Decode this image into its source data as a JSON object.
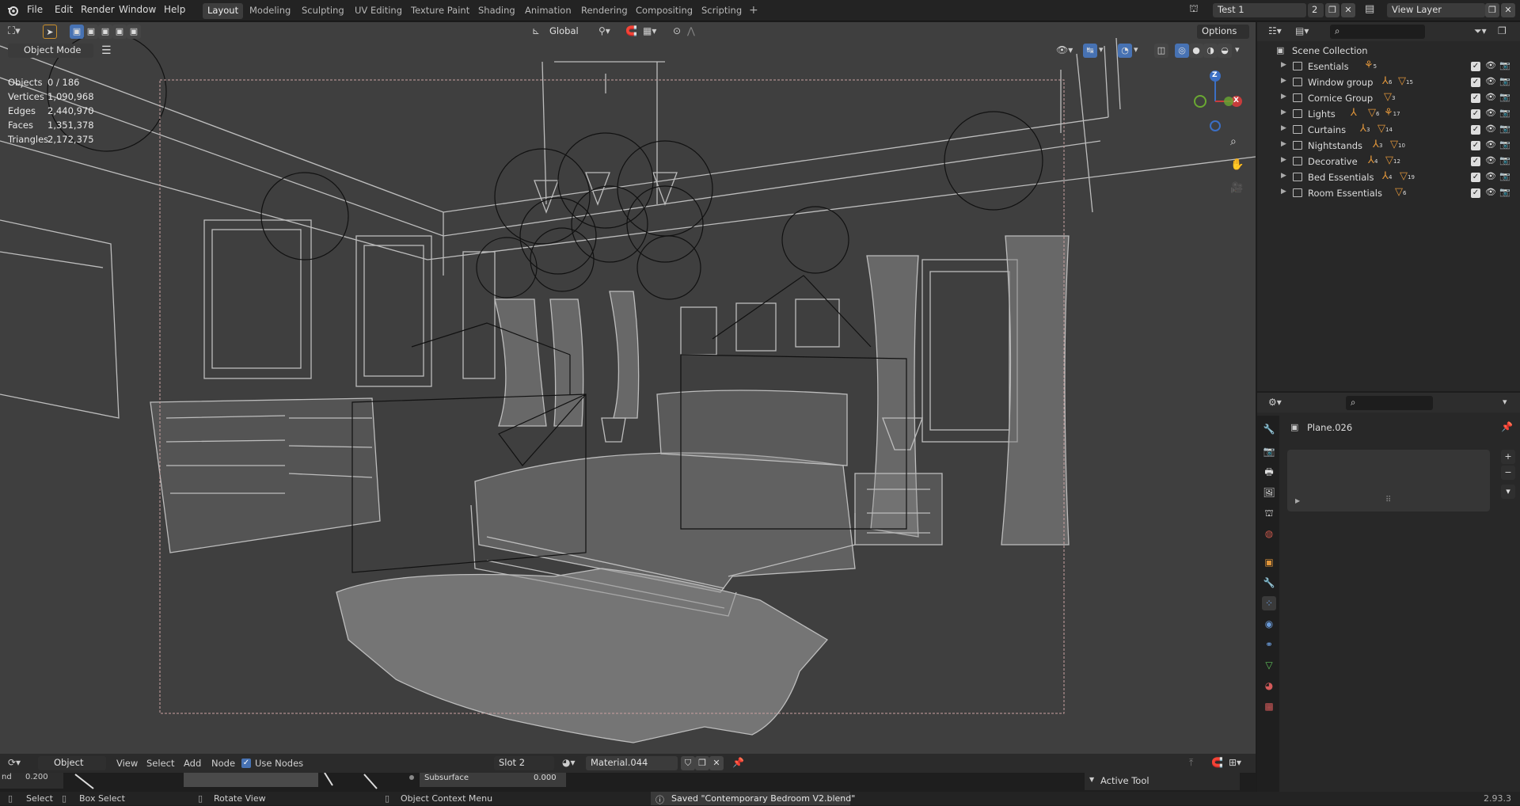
{
  "menus": {
    "file": "File",
    "edit": "Edit",
    "render": "Render",
    "window": "Window",
    "help": "Help"
  },
  "workspaces": [
    "Layout",
    "Modeling",
    "Sculpting",
    "UV Editing",
    "Texture Paint",
    "Shading",
    "Animation",
    "Rendering",
    "Compositing",
    "Scripting"
  ],
  "scene": {
    "name": "Test 1",
    "users": "2",
    "view_layer": "View Layer"
  },
  "viewport": {
    "mode": "Object Mode",
    "orientation": "Global",
    "options": "Options",
    "stats": [
      {
        "label": "Objects",
        "value": "0 / 186"
      },
      {
        "label": "Vertices",
        "value": "1,090,968"
      },
      {
        "label": "Edges",
        "value": "2,440,970"
      },
      {
        "label": "Faces",
        "value": "1,351,378"
      },
      {
        "label": "Triangles",
        "value": "2,172,375"
      }
    ],
    "gizmo": {
      "z": "Z",
      "x": "X"
    }
  },
  "outliner": {
    "root": "Scene Collection",
    "items": [
      {
        "name": "Esentials",
        "badges": [
          "5"
        ]
      },
      {
        "name": "Window group",
        "badges": [
          "6",
          "15"
        ]
      },
      {
        "name": "Cornice Group",
        "badges": [
          "3"
        ]
      },
      {
        "name": "Lights",
        "badges": [
          "6",
          "17"
        ]
      },
      {
        "name": "Curtains",
        "badges": [
          "3",
          "14"
        ]
      },
      {
        "name": "Nightstands",
        "badges": [
          "3",
          "10"
        ]
      },
      {
        "name": "Decorative",
        "badges": [
          "4",
          "12"
        ]
      },
      {
        "name": "Bed Essentials",
        "badges": [
          "4",
          "19"
        ]
      },
      {
        "name": "Room Essentials",
        "badges": [
          "6"
        ]
      }
    ]
  },
  "properties": {
    "object": "Plane.026"
  },
  "node_editor": {
    "type": "Object",
    "menus": [
      "View",
      "Select",
      "Add",
      "Node"
    ],
    "use_nodes": "Use Nodes",
    "slot": "Slot 2",
    "material": "Material.044",
    "row2_left": "nd",
    "row2_val": "0.200",
    "subsurface_label": "Subsurface",
    "subsurface_value": "0.000",
    "active_tool": "Active Tool"
  },
  "status": {
    "select": "Select",
    "box_select": "Box Select",
    "rotate": "Rotate View",
    "context_menu": "Object Context Menu",
    "message": "Saved \"Contemporary Bedroom V2.blend\"",
    "version": "2.93.3"
  }
}
